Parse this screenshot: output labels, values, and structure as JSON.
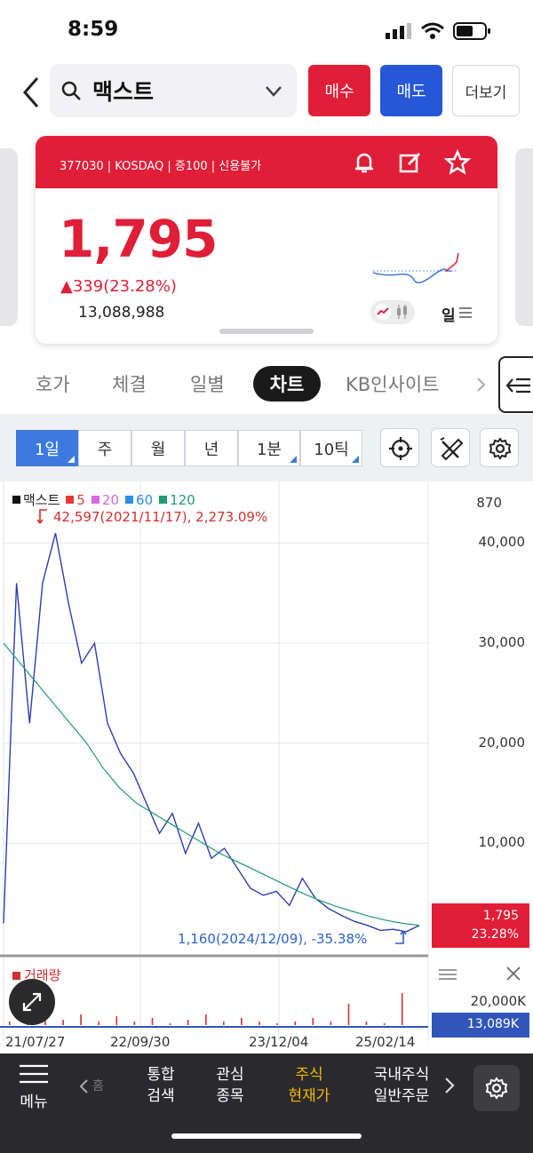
{
  "status": {
    "time": "8:59"
  },
  "search": {
    "query": "맥스트"
  },
  "actions": {
    "buy": "매수",
    "sell": "매도",
    "more": "더보기"
  },
  "stock": {
    "meta": "377030 | KOSDAQ | 증100 | 신용불가",
    "price": "1,795",
    "change": "▲339(23.28%)",
    "volume": "13,088,988",
    "period": "일"
  },
  "tabs": [
    {
      "label": "호가"
    },
    {
      "label": "체결"
    },
    {
      "label": "일별"
    },
    {
      "label": "차트",
      "active": true
    },
    {
      "label": "KB인사이트"
    }
  ],
  "toolbar": {
    "segments": [
      "1일",
      "주",
      "월",
      "년",
      "1분",
      "10틱"
    ],
    "active": "1일"
  },
  "legend": {
    "name": "맥스트",
    "ma": [
      {
        "label": "5",
        "color": "#e53935"
      },
      {
        "label": "20",
        "color": "#d46be0"
      },
      {
        "label": "60",
        "color": "#2e8bea"
      },
      {
        "label": "120",
        "color": "#1f9a73"
      }
    ]
  },
  "annotations": {
    "high": "42,597(2021/11/17), 2,273.09%",
    "low": "1,160(2024/12/09), -35.38%"
  },
  "chart_data": {
    "type": "line",
    "y_top_label": "870",
    "y_ticks": [
      "40,000",
      "30,000",
      "20,000",
      "10,000"
    ],
    "ylim": [
      0,
      43500
    ],
    "x_labels": [
      "21/07/27",
      "22/09/30",
      "23/12/04",
      "25/02/14"
    ],
    "current_price": "1,795",
    "current_change": "23.28%",
    "series": [
      {
        "name": "맥스트",
        "values": [
          2000,
          36000,
          22000,
          36000,
          41000,
          34000,
          28000,
          30000,
          22000,
          19000,
          17000,
          14000,
          11000,
          13000,
          9000,
          12000,
          8500,
          9500,
          7500,
          5500,
          4800,
          5200,
          3800,
          6500,
          4500,
          3500,
          2800,
          2200,
          1800,
          1300,
          1400,
          1160,
          1795
        ]
      },
      {
        "name": "120",
        "values": [
          30000,
          28000,
          26000,
          24000,
          22000,
          20000,
          17500,
          15500,
          14000,
          13000,
          12000,
          11000,
          10000,
          9000,
          8200,
          7400,
          6600,
          5800,
          5000,
          4300,
          3700,
          3200,
          2700,
          2300,
          2000,
          1800
        ]
      }
    ],
    "volume": {
      "label": "거래량",
      "max_label": "20,000K",
      "current_label": "13,089K"
    }
  },
  "bottom_nav": {
    "menu": "메뉴",
    "prev": "홈",
    "items": [
      {
        "line1": "통합",
        "line2": "검색"
      },
      {
        "line1": "관심",
        "line2": "종목"
      },
      {
        "line1": "주식",
        "line2": "현재가",
        "active": true
      },
      {
        "line1": "국내주식",
        "line2": "일반주문"
      }
    ]
  },
  "colors": {
    "red": "#e01e37",
    "blue": "#2657d6",
    "active_tab_text": "#f5b800"
  }
}
